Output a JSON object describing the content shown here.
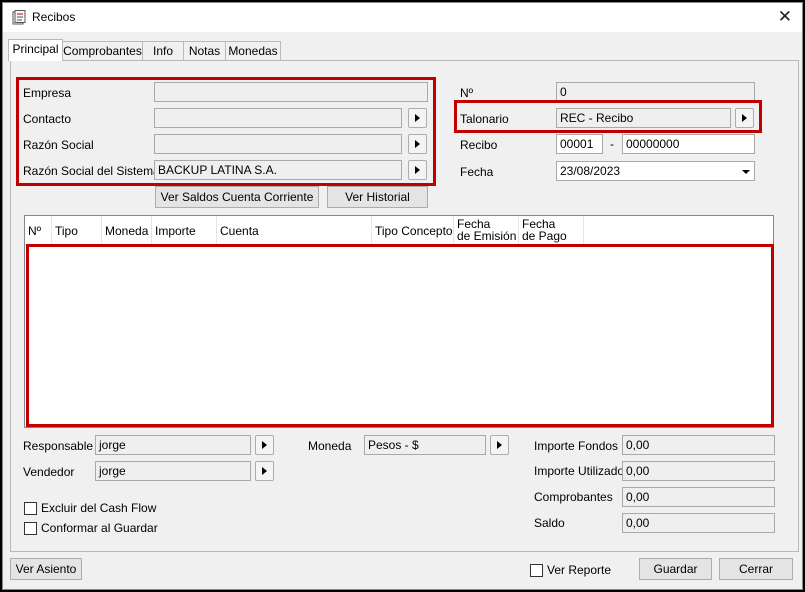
{
  "window": {
    "title": "Recibos",
    "close_glyph": "✕"
  },
  "tabs": [
    {
      "label": "Principal"
    },
    {
      "label": "Comprobantes"
    },
    {
      "label": "Info"
    },
    {
      "label": "Notas"
    },
    {
      "label": "Monedas"
    }
  ],
  "left_form": {
    "empresa_label": "Empresa",
    "empresa_value": "",
    "contacto_label": "Contacto",
    "contacto_value": "",
    "razon_social_label": "Razón Social",
    "razon_social_value": "",
    "razon_sistema_label": "Razón Social del Sistema",
    "razon_sistema_value": "BACKUP LATINA S.A.",
    "ver_saldos_label": "Ver Saldos Cuenta Corriente",
    "ver_historial_label": "Ver Historial"
  },
  "right_form": {
    "numero_label": "Nº",
    "numero_value": "0",
    "talonario_label": "Talonario",
    "talonario_value": "REC - Recibo",
    "recibo_label": "Recibo",
    "recibo_prefix": "00001",
    "recibo_separator": "-",
    "recibo_number": "00000000",
    "fecha_label": "Fecha",
    "fecha_value": "23/08/2023"
  },
  "grid": {
    "columns": [
      {
        "line1": "Nº",
        "line2": ""
      },
      {
        "line1": "Tipo",
        "line2": ""
      },
      {
        "line1": "Moneda",
        "line2": ""
      },
      {
        "line1": "Importe",
        "line2": ""
      },
      {
        "line1": "Cuenta",
        "line2": ""
      },
      {
        "line1": "Tipo Concepto",
        "line2": ""
      },
      {
        "line1": "Fecha",
        "line2": "de Emisión"
      },
      {
        "line1": "Fecha",
        "line2": "de Pago"
      }
    ],
    "rows": []
  },
  "bottom_left": {
    "responsable_label": "Responsable",
    "responsable_value": "jorge",
    "vendedor_label": "Vendedor",
    "vendedor_value": "jorge",
    "moneda_label": "Moneda",
    "moneda_value": "Pesos - $",
    "excluir_label": "Excluir del Cash Flow",
    "conformar_label": "Conformar al Guardar"
  },
  "totals": {
    "importe_fondos_label": "Importe Fondos",
    "importe_fondos_value": "0,00",
    "importe_utilizado_label": "Importe Utilizado",
    "importe_utilizado_value": "0,00",
    "comprobantes_label": "Comprobantes",
    "comprobantes_value": "0,00",
    "saldo_label": "Saldo",
    "saldo_value": "0,00"
  },
  "footer": {
    "ver_asiento_label": "Ver Asiento",
    "ver_reporte_label": "Ver Reporte",
    "guardar_label": "Guardar",
    "cerrar_label": "Cerrar"
  },
  "colors": {
    "highlight": "#c00000",
    "window_bg": "#f0f0f0"
  }
}
